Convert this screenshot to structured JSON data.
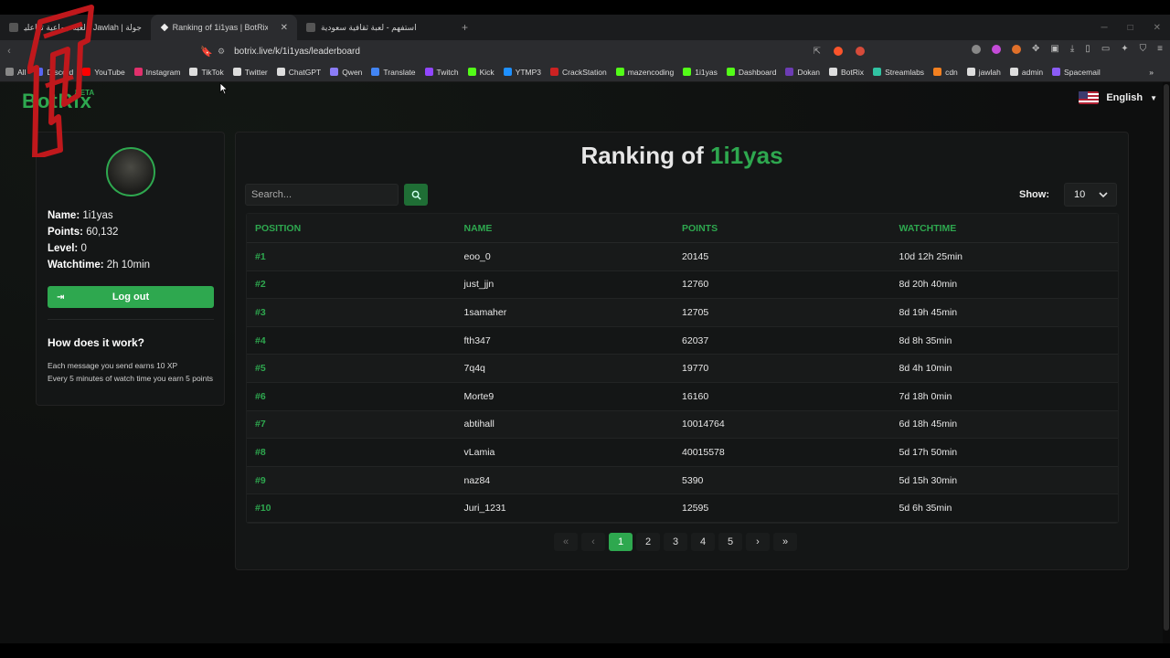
{
  "browser": {
    "tabs": [
      {
        "label": "جولة | Jawlah - لعبة جماعية تفاعلية",
        "active": false
      },
      {
        "label": "Ranking of 1i1yas | BotRix — Cl...",
        "active": true
      },
      {
        "label": "استفهم - لعبة ثقافية سعودية",
        "active": false
      }
    ],
    "new_tab_symbol": "+",
    "url": "botrix.live/k/1i1yas/leaderboard",
    "bookmarks": [
      {
        "label": "All",
        "color": "#888888"
      },
      {
        "label": "Discord",
        "color": "#5865F2"
      },
      {
        "label": "YouTube",
        "color": "#ff0000"
      },
      {
        "label": "Instagram",
        "color": "#e1306c"
      },
      {
        "label": "TikTok",
        "color": "#dddddd"
      },
      {
        "label": "Twitter",
        "color": "#dddddd"
      },
      {
        "label": "ChatGPT",
        "color": "#dddddd"
      },
      {
        "label": "Qwen",
        "color": "#8b7cf6"
      },
      {
        "label": "Translate",
        "color": "#4285f4"
      },
      {
        "label": "Twitch",
        "color": "#9146ff"
      },
      {
        "label": "Kick",
        "color": "#53fc18"
      },
      {
        "label": "YTMP3",
        "color": "#1e90ff"
      },
      {
        "label": "CrackStation",
        "color": "#cc2222"
      },
      {
        "label": "mazencoding",
        "color": "#53fc18"
      },
      {
        "label": "1i1yas",
        "color": "#53fc18"
      },
      {
        "label": "Dashboard",
        "color": "#53fc18"
      },
      {
        "label": "Dokan",
        "color": "#6c3cb4"
      },
      {
        "label": "BotRix",
        "color": "#dddddd"
      },
      {
        "label": "Streamlabs",
        "color": "#31c3a2"
      },
      {
        "label": "cdn",
        "color": "#f38020"
      },
      {
        "label": "jawlah",
        "color": "#dddddd"
      },
      {
        "label": "admin",
        "color": "#dddddd"
      },
      {
        "label": "Spacemail",
        "color": "#8b5cf6"
      }
    ],
    "more_bookmarks": "»"
  },
  "site": {
    "logo": "BotRix",
    "beta": "BETA",
    "language": "English"
  },
  "profile": {
    "name_label": "Name:",
    "name": "1i1yas",
    "points_label": "Points:",
    "points": "60,132",
    "level_label": "Level:",
    "level": "0",
    "watchtime_label": "Watchtime:",
    "watchtime": "2h 10min",
    "logout": "Log out",
    "how_title": "How does it work?",
    "how_line1": "Each message you send earns 10 XP",
    "how_line2": "Every 5 minutes of watch time you earn 5 points"
  },
  "ranking": {
    "title_prefix": "Ranking of",
    "title_user": "1i1yas",
    "search_placeholder": "Search...",
    "show_label": "Show:",
    "show_value": "10",
    "columns": [
      "POSITION",
      "NAME",
      "POINTS",
      "WATCHTIME"
    ],
    "rows": [
      {
        "position": "#1",
        "name": "eoo_0",
        "points": "20145",
        "watchtime": "10d 12h 25min"
      },
      {
        "position": "#2",
        "name": "just_jjn",
        "points": "12760",
        "watchtime": "8d 20h 40min"
      },
      {
        "position": "#3",
        "name": "1samaher",
        "points": "12705",
        "watchtime": "8d 19h 45min"
      },
      {
        "position": "#4",
        "name": "fth347",
        "points": "62037",
        "watchtime": "8d 8h 35min"
      },
      {
        "position": "#5",
        "name": "7q4q",
        "points": "19770",
        "watchtime": "8d 4h 10min"
      },
      {
        "position": "#6",
        "name": "Morte9",
        "points": "16160",
        "watchtime": "7d 18h 0min"
      },
      {
        "position": "#7",
        "name": "abtihall",
        "points": "10014764",
        "watchtime": "6d 18h 45min"
      },
      {
        "position": "#8",
        "name": "vLamia",
        "points": "40015578",
        "watchtime": "5d 17h 50min"
      },
      {
        "position": "#9",
        "name": "naz84",
        "points": "5390",
        "watchtime": "5d 15h 30min"
      },
      {
        "position": "#10",
        "name": "Juri_1231",
        "points": "12595",
        "watchtime": "5d 6h 35min"
      }
    ],
    "pages": [
      "1",
      "2",
      "3",
      "4",
      "5"
    ],
    "first_symbol": "«",
    "prev_symbol": "‹",
    "next_symbol": "›",
    "last_symbol": "»"
  },
  "colors": {
    "accent": "#2ea84f",
    "background": "#0e0f0f",
    "card": "#141616"
  }
}
